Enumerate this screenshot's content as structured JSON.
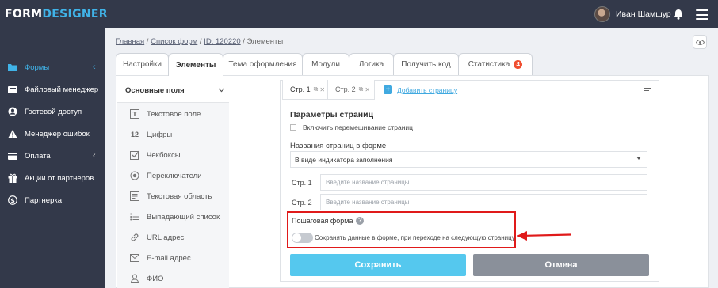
{
  "app": {
    "logo_part1": "FORM",
    "logo_part2": "DESIGNER"
  },
  "header": {
    "username": "Иван Шамшур"
  },
  "sidebar": {
    "items": [
      {
        "label": "Формы",
        "icon": "folder-icon",
        "active": true,
        "has_chevron": true
      },
      {
        "label": "Файловый менеджер",
        "icon": "file-manager-icon",
        "active": false,
        "has_chevron": false
      },
      {
        "label": "Гостевой доступ",
        "icon": "user-icon",
        "active": false,
        "has_chevron": false
      },
      {
        "label": "Менеджер ошибок",
        "icon": "warning-icon",
        "active": false,
        "has_chevron": false
      },
      {
        "label": "Оплата",
        "icon": "card-icon",
        "active": false,
        "has_chevron": true
      },
      {
        "label": "Акции от партнеров",
        "icon": "gift-icon",
        "active": false,
        "has_chevron": false
      },
      {
        "label": "Партнерка",
        "icon": "dollar-icon",
        "active": false,
        "has_chevron": false
      }
    ],
    "chevron": "‹"
  },
  "breadcrumb": {
    "home": "Главная",
    "sep": " / ",
    "forms": "Список форм",
    "id": "ID: 120220",
    "current": "Элементы"
  },
  "tabs": [
    {
      "label": "Настройки"
    },
    {
      "label": "Элементы",
      "active": true
    },
    {
      "label": "Тема оформления"
    },
    {
      "label": "Модули"
    },
    {
      "label": "Логика"
    },
    {
      "label": "Получить код"
    },
    {
      "label": "Статистика",
      "badge": "4"
    }
  ],
  "fields_panel": {
    "title": "Основные поля",
    "items": [
      {
        "label": "Текстовое поле",
        "icon": "text-field-icon"
      },
      {
        "label": "Цифры",
        "icon": "numbers-icon",
        "glyph": "12"
      },
      {
        "label": "Чекбоксы",
        "icon": "checkbox-icon"
      },
      {
        "label": "Переключатели",
        "icon": "radio-icon"
      },
      {
        "label": "Текстовая область",
        "icon": "textarea-icon"
      },
      {
        "label": "Выпадающий список",
        "icon": "list-icon"
      },
      {
        "label": "URL адрес",
        "icon": "link-icon"
      },
      {
        "label": "E-mail адрес",
        "icon": "mail-icon"
      },
      {
        "label": "ФИО",
        "icon": "person-icon"
      }
    ]
  },
  "editor": {
    "page_tabs": [
      {
        "label": "Стр. 1"
      },
      {
        "label": "Стр. 2"
      }
    ],
    "add_page": "Добавить страницу",
    "section_title": "Параметры страниц",
    "shuffle_label": "Включить перемешивание страниц",
    "names_label": "Названия страниц в форме",
    "names_select_value": "В виде индикатора заполнения",
    "page_rows": [
      {
        "label": "Стр. 1",
        "placeholder": "Введите название страницы"
      },
      {
        "label": "Стр. 2",
        "placeholder": "Введите название страницы"
      }
    ],
    "step_title": "Пошаговая форма",
    "step_toggle_label": "Сохранять данные в форме, при переходе на следующую страницу",
    "step_toggle_on": false,
    "save_label": "Сохранить",
    "cancel_label": "Отмена"
  },
  "colors": {
    "accent": "#40b3e8",
    "sidebar_bg": "#33394a",
    "highlight": "#e01a1a",
    "badge": "#f04d2f"
  }
}
